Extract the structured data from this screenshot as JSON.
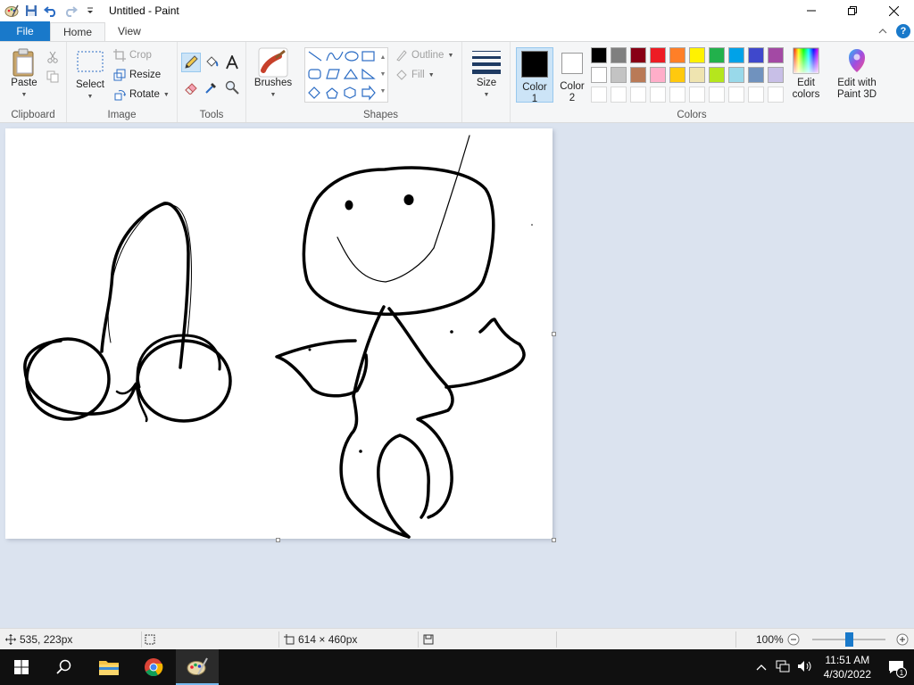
{
  "window": {
    "title": "Untitled - Paint"
  },
  "tabs": [
    {
      "label": "File"
    },
    {
      "label": "Home"
    },
    {
      "label": "View"
    }
  ],
  "ribbon": {
    "clipboard": {
      "label": "Clipboard",
      "paste": "Paste"
    },
    "image": {
      "label": "Image",
      "select": "Select",
      "crop": "Crop",
      "resize": "Resize",
      "rotate": "Rotate"
    },
    "tools": {
      "label": "Tools"
    },
    "brushes": {
      "label": "Brushes"
    },
    "shapes": {
      "label": "Shapes",
      "outline": "Outline",
      "fill": "Fill"
    },
    "size": {
      "label": "Size"
    },
    "colors": {
      "label": "Colors",
      "color1_line1": "Color",
      "color1_line2": "1",
      "color2_line1": "Color",
      "color2_line2": "2",
      "edit_colors_line1": "Edit",
      "edit_colors_line2": "colors",
      "paint3d_line1": "Edit with",
      "paint3d_line2": "Paint 3D",
      "color1_value": "#000000",
      "color2_value": "#ffffff",
      "palette_row1": [
        "#000000",
        "#7f7f7f",
        "#880015",
        "#ed1c24",
        "#ff7f27",
        "#fff200",
        "#22b14c",
        "#00a2e8",
        "#3f48cc",
        "#a349a4"
      ],
      "palette_row2": [
        "#ffffff",
        "#c3c3c3",
        "#b97a57",
        "#ffaec9",
        "#ffc90e",
        "#efe4b0",
        "#b5e61d",
        "#99d9ea",
        "#7092be",
        "#c8bfe7"
      ]
    }
  },
  "status": {
    "cursor_pos": "535, 223px",
    "canvas_size": "614 × 460px",
    "zoom": "100%",
    "zoom_fraction": 0.5
  },
  "taskbar": {
    "time": "11:51 AM",
    "date": "4/30/2022",
    "notification_count": "1"
  }
}
